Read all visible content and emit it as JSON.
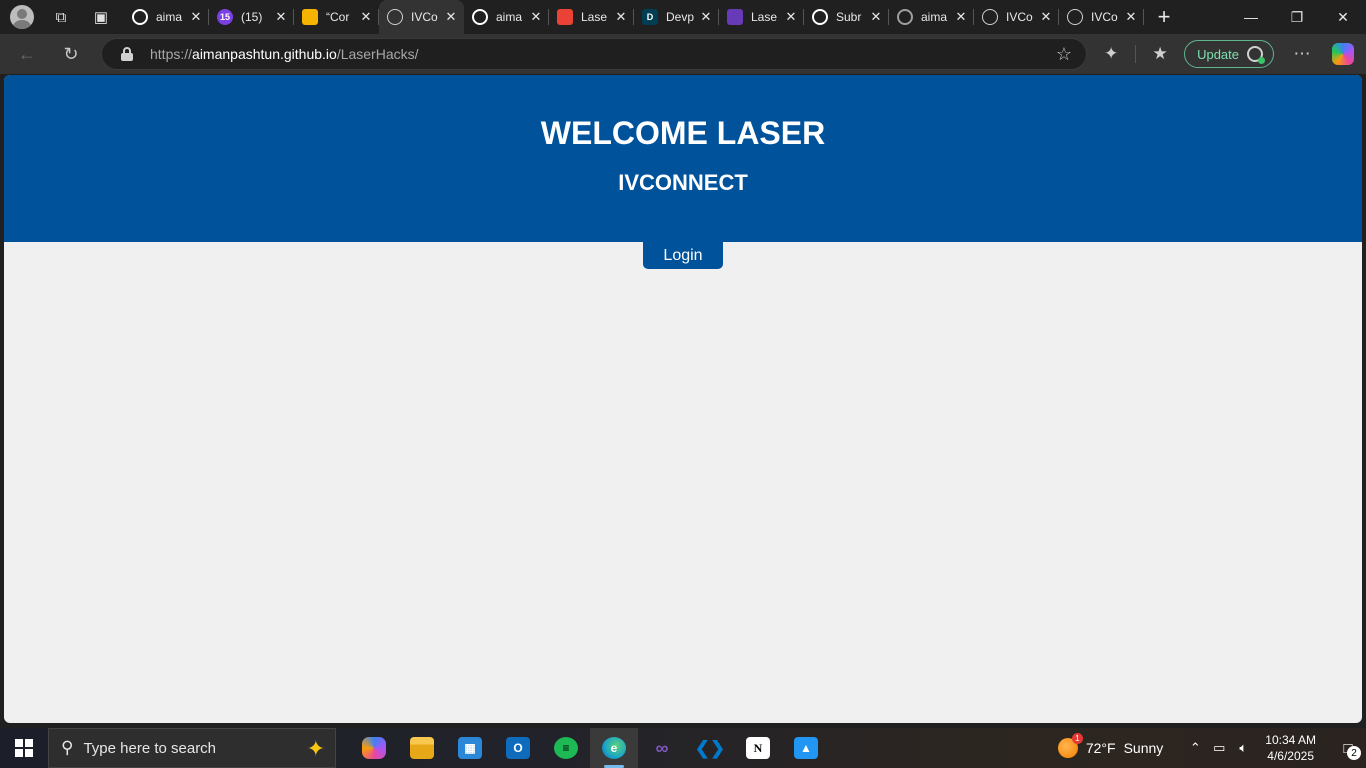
{
  "browser": {
    "tabs": [
      {
        "title": "aima",
        "icon": "github-icon",
        "color": "#ffffff"
      },
      {
        "title": "(15)",
        "icon": "calendar-badge-icon",
        "color": "#7b3fe4",
        "badge": "15"
      },
      {
        "title": "“Cor",
        "icon": "slides-icon",
        "color": "#f4b400"
      },
      {
        "title": "IVCo",
        "icon": "globe-icon",
        "color": "#d0d0d0",
        "active": true
      },
      {
        "title": "aima",
        "icon": "github-icon",
        "color": "#ffffff"
      },
      {
        "title": "Lase",
        "icon": "gmail-icon",
        "color": "#ea4335"
      },
      {
        "title": "Devp",
        "icon": "devpost-icon",
        "color": "#003e54",
        "letter": "D"
      },
      {
        "title": "Lase",
        "icon": "forms-icon",
        "color": "#673ab7"
      },
      {
        "title": "Subr",
        "icon": "openai-icon",
        "color": "#ffffff"
      },
      {
        "title": "aima",
        "icon": "github-icon",
        "color": "#9e9e9e"
      },
      {
        "title": "IVCo",
        "icon": "globe-icon",
        "color": "#d0d0d0"
      },
      {
        "title": "IVCo",
        "icon": "globe-icon",
        "color": "#d0d0d0"
      }
    ],
    "tab_close_glyph": "✕",
    "new_tab_glyph": "+",
    "url_scheme": "https://",
    "url_host": "aimanpashtun.github.io",
    "url_path": "/LaserHacks/",
    "update_label": "Update"
  },
  "page": {
    "heading": "WELCOME LASER",
    "subheading": "IVCONNECT",
    "login_label": "Login",
    "brand_color": "#00529b",
    "background_color": "#f0f0f0"
  },
  "taskbar": {
    "search_placeholder": "Type here to search",
    "apps": [
      {
        "name": "copilot-app",
        "color": "#a855f7",
        "glyph": ""
      },
      {
        "name": "file-explorer-app",
        "color": "#f9c74f",
        "glyph": ""
      },
      {
        "name": "microsoft-store-app",
        "color": "#2b88d8",
        "glyph": "▦"
      },
      {
        "name": "outlook-app",
        "color": "#0f6cbd",
        "glyph": "O"
      },
      {
        "name": "spotify-app",
        "color": "#1db954",
        "glyph": "≡"
      },
      {
        "name": "edge-app",
        "color": "#1aa3c8",
        "glyph": "e",
        "active": true
      },
      {
        "name": "visual-studio-app",
        "color": "#7e57c2",
        "glyph": "∞"
      },
      {
        "name": "vscode-app",
        "color": "#007acc",
        "glyph": "❮❯"
      },
      {
        "name": "notion-app",
        "color": "#ffffff",
        "glyph": "N"
      },
      {
        "name": "photos-app",
        "color": "#2196f3",
        "glyph": "▲"
      }
    ],
    "weather_temp": "72°F",
    "weather_condition": "Sunny",
    "weather_badge": "1",
    "time": "10:34 AM",
    "date": "4/6/2025",
    "notification_count": "2"
  }
}
